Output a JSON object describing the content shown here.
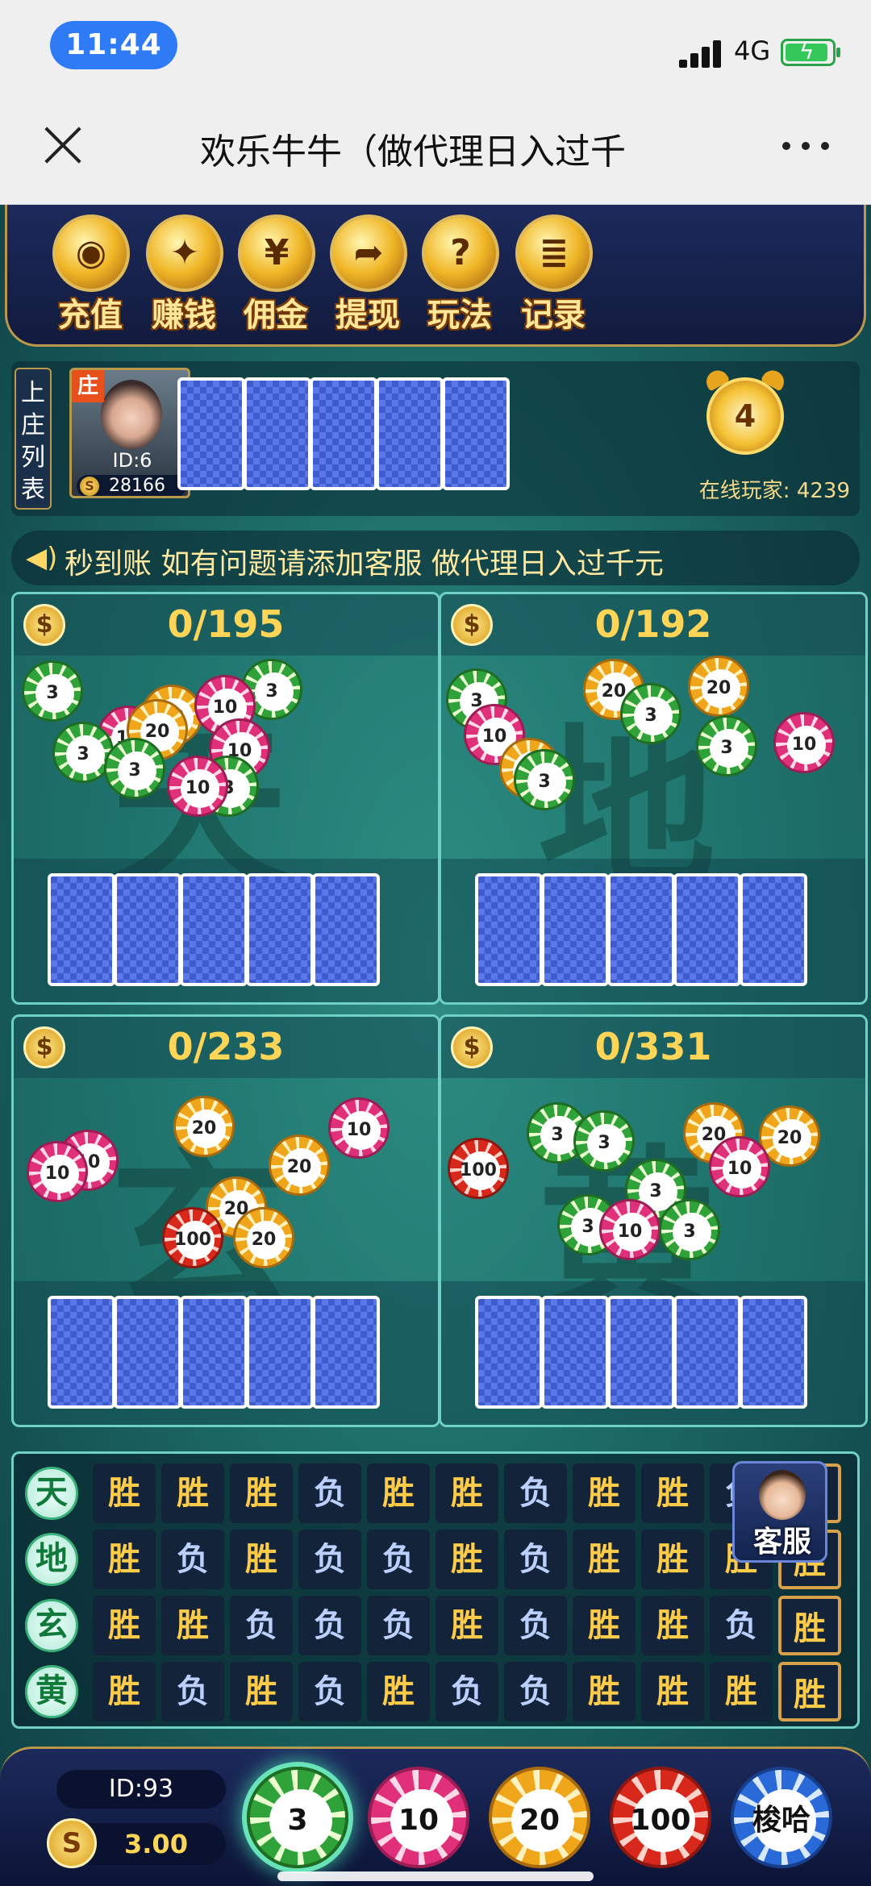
{
  "status": {
    "time": "11:44",
    "network": "4G"
  },
  "nav": {
    "title": "欢乐牛牛（做代理日入过千"
  },
  "menu": [
    {
      "label": "充值",
      "icon": "coins-icon",
      "glyph": "◉"
    },
    {
      "label": "赚钱",
      "icon": "gift-icon",
      "glyph": "✦"
    },
    {
      "label": "佣金",
      "icon": "money-bag-icon",
      "glyph": "¥"
    },
    {
      "label": "提现",
      "icon": "withdraw-icon",
      "glyph": "➦"
    },
    {
      "label": "玩法",
      "icon": "help-icon",
      "glyph": "?"
    },
    {
      "label": "记录",
      "icon": "record-icon",
      "glyph": "≣"
    }
  ],
  "banker": {
    "list_label": "上庄列表",
    "badge": "庄",
    "id": "ID:6",
    "coins": "28166"
  },
  "timer": {
    "value": "4",
    "online": "在线玩家: 4239"
  },
  "marquee": "秒到账 如有问题请添加客服 做代理日入过千元",
  "zones": [
    {
      "key": "tian",
      "count": "0/195",
      "char": "天"
    },
    {
      "key": "di",
      "count": "0/192",
      "char": "地"
    },
    {
      "key": "xuan",
      "count": "0/233",
      "char": "玄"
    },
    {
      "key": "huang",
      "count": "0/331",
      "char": "黄"
    }
  ],
  "board": {
    "rows": [
      {
        "label": "天",
        "cells": [
          "胜",
          "胜",
          "胜",
          "负",
          "胜",
          "胜",
          "负",
          "胜",
          "胜",
          "负",
          "胜"
        ]
      },
      {
        "label": "地",
        "cells": [
          "胜",
          "负",
          "胜",
          "负",
          "负",
          "胜",
          "负",
          "胜",
          "胜",
          "胜",
          "胜"
        ]
      },
      {
        "label": "玄",
        "cells": [
          "胜",
          "胜",
          "负",
          "负",
          "负",
          "胜",
          "负",
          "胜",
          "胜",
          "负",
          "胜"
        ]
      },
      {
        "label": "黄",
        "cells": [
          "胜",
          "负",
          "胜",
          "负",
          "胜",
          "负",
          "负",
          "胜",
          "胜",
          "胜",
          "胜"
        ]
      }
    ],
    "service_label": "客服"
  },
  "player": {
    "id": "ID:93",
    "balance": "3.00"
  },
  "bet_chips": [
    "3",
    "10",
    "20",
    "100",
    "梭哈"
  ],
  "selected_chip": "3"
}
